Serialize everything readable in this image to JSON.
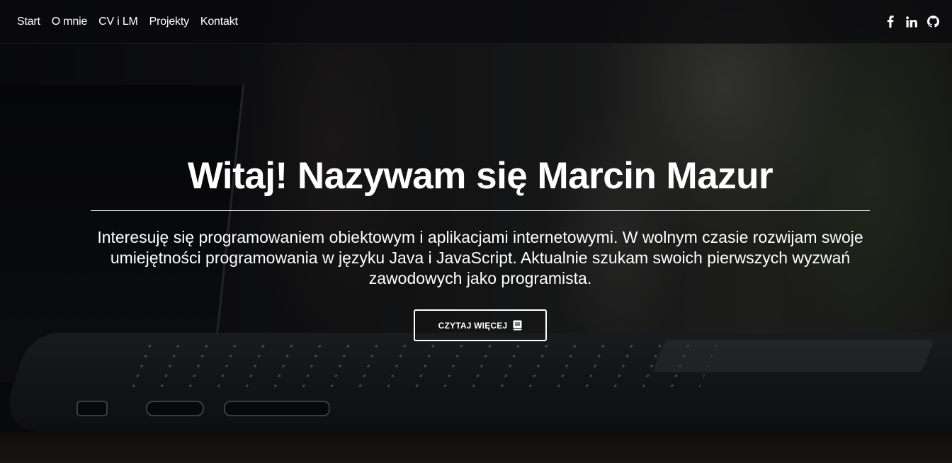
{
  "nav": {
    "links": [
      {
        "label": "Start"
      },
      {
        "label": "O mnie"
      },
      {
        "label": "CV i LM"
      },
      {
        "label": "Projekty"
      },
      {
        "label": "Kontakt"
      }
    ],
    "social": [
      {
        "icon": "facebook-icon"
      },
      {
        "icon": "linkedin-icon"
      },
      {
        "icon": "github-icon"
      }
    ]
  },
  "hero": {
    "title": "Witaj! Nazywam się Marcin Mazur",
    "text": "Interesuję się programowaniem obiektowym i aplikacjami internetowymi. W wolnym czasie rozwijam swoje umiejętności programowania w języku Java i JavaScript. Aktualnie szukam swoich pierwszych wyzwań zawodowych jako programista.",
    "button_label": "CZYTAJ WIĘCEJ",
    "button_icon": "book-icon"
  },
  "colors": {
    "text": "#ffffff",
    "navbar_bg": "#0a0a0c",
    "overlay": "#000000"
  }
}
